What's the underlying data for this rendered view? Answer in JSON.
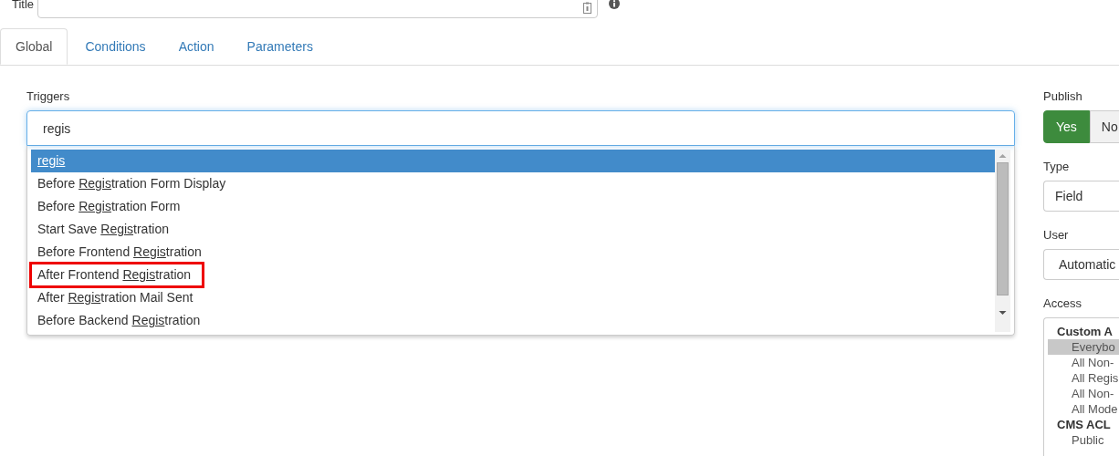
{
  "title_field": {
    "label": "Title"
  },
  "tabs": [
    {
      "label": "Global",
      "selected": true
    },
    {
      "label": "Conditions",
      "selected": false
    },
    {
      "label": "Action",
      "selected": false
    },
    {
      "label": "Parameters",
      "selected": false
    }
  ],
  "triggers": {
    "label": "Triggers",
    "value": "regis",
    "options": [
      {
        "match": "regis",
        "selected": true,
        "highlighted": false
      },
      {
        "before": "Before ",
        "match": "Regis",
        "after": "tration Form Display",
        "selected": false,
        "highlighted": false
      },
      {
        "before": "Before ",
        "match": "Regis",
        "after": "tration Form",
        "selected": false,
        "highlighted": false
      },
      {
        "before": "Start Save ",
        "match": "Regis",
        "after": "tration",
        "selected": false,
        "highlighted": false
      },
      {
        "before": "Before Frontend ",
        "match": "Regis",
        "after": "tration",
        "selected": false,
        "highlighted": false
      },
      {
        "before": "After Frontend ",
        "match": "Regis",
        "after": "tration",
        "selected": false,
        "highlighted": true
      },
      {
        "before": "After ",
        "match": "Regis",
        "after": "tration Mail Sent",
        "selected": false,
        "highlighted": false
      },
      {
        "before": "Before Backend ",
        "match": "Regis",
        "after": "tration",
        "selected": false,
        "highlighted": false
      }
    ]
  },
  "publish": {
    "label": "Publish",
    "options": [
      {
        "label": "Yes",
        "selected": true
      },
      {
        "label": "No",
        "selected": false
      }
    ]
  },
  "type": {
    "label": "Type",
    "value": "Field"
  },
  "user": {
    "label": "User",
    "value": "Automatic"
  },
  "access": {
    "label": "Access",
    "items": [
      {
        "kind": "group",
        "label": "Custom A",
        "selected": false
      },
      {
        "kind": "option",
        "label": "Everybo",
        "selected": true
      },
      {
        "kind": "option",
        "label": "All Non-",
        "selected": false
      },
      {
        "kind": "option",
        "label": "All Regis",
        "selected": false
      },
      {
        "kind": "option",
        "label": "All Non-",
        "selected": false
      },
      {
        "kind": "option",
        "label": "All Mode",
        "selected": false
      },
      {
        "kind": "group",
        "label": "CMS ACL",
        "selected": false
      },
      {
        "kind": "option",
        "label": "Public",
        "selected": false
      }
    ]
  }
}
